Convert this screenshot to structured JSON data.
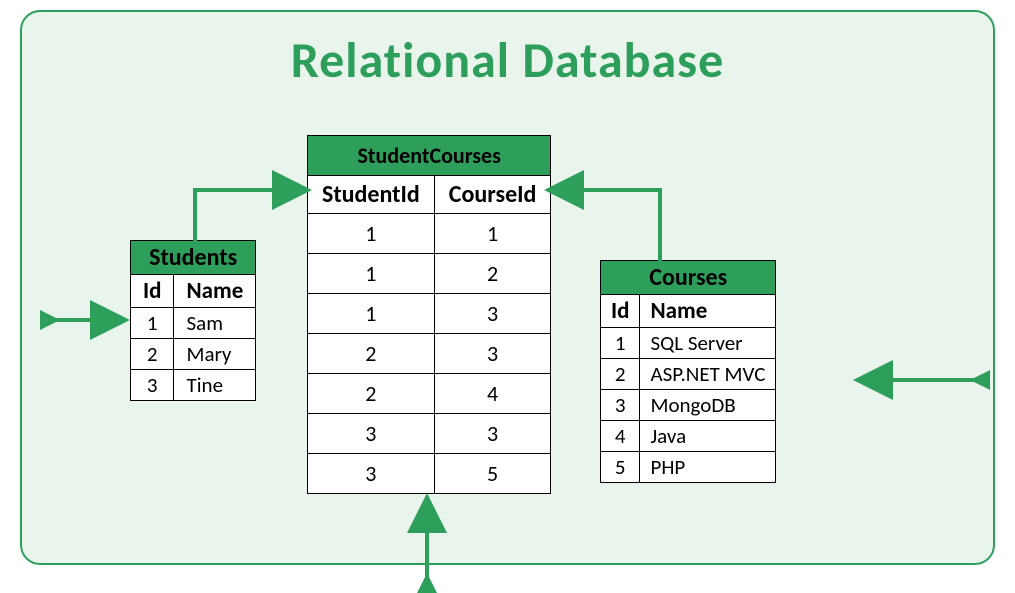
{
  "title": "Relational Database",
  "students": {
    "name": "Students",
    "cols": [
      "Id",
      "Name"
    ],
    "rows": [
      {
        "id": "1",
        "name": "Sam"
      },
      {
        "id": "2",
        "name": "Mary"
      },
      {
        "id": "3",
        "name": "Tine"
      }
    ]
  },
  "studentCourses": {
    "name": "StudentCourses",
    "cols": [
      "StudentId",
      "CourseId"
    ],
    "rows": [
      {
        "sid": "1",
        "cid": "1"
      },
      {
        "sid": "1",
        "cid": "2"
      },
      {
        "sid": "1",
        "cid": "3"
      },
      {
        "sid": "2",
        "cid": "3"
      },
      {
        "sid": "2",
        "cid": "4"
      },
      {
        "sid": "3",
        "cid": "3"
      },
      {
        "sid": "3",
        "cid": "5"
      }
    ]
  },
  "courses": {
    "name": "Courses",
    "cols": [
      "Id",
      "Name"
    ],
    "rows": [
      {
        "id": "1",
        "name": "SQL Server"
      },
      {
        "id": "2",
        "name": "ASP.NET MVC"
      },
      {
        "id": "3",
        "name": "MongoDB"
      },
      {
        "id": "4",
        "name": "Java"
      },
      {
        "id": "5",
        "name": "PHP"
      }
    ]
  }
}
